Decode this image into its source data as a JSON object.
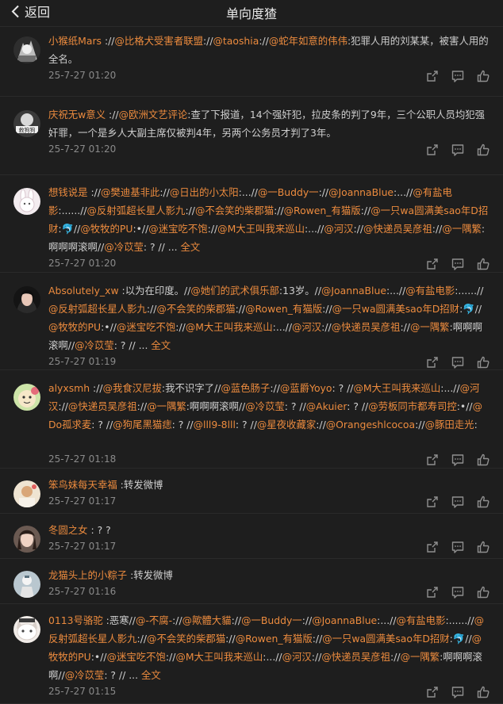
{
  "header": {
    "back_label": "返回",
    "title": "单向度猹"
  },
  "comments": [
    {
      "avatar": "avatar-anime-dark",
      "author": "小猴纸Mars",
      "segments": [
        {
          "t": " ://",
          "k": "n"
        },
        {
          "t": "@比格犬受害者联盟",
          "k": "m"
        },
        {
          "t": "://",
          "k": "n"
        },
        {
          "t": "@taoshia",
          "k": "m"
        },
        {
          "t": "://",
          "k": "n"
        },
        {
          "t": "@蛇年如意的伟伟",
          "k": "m"
        },
        {
          "t": ":犯罪人用的刘某某，被害人用的全名。",
          "k": "n"
        }
      ],
      "time": "25-7-27 01:20"
    },
    {
      "avatar": "avatar-text-badge",
      "author": "庆祝无w意义",
      "segments": [
        {
          "t": " ://",
          "k": "n"
        },
        {
          "t": "@欧洲文艺评论",
          "k": "m"
        },
        {
          "t": ":查了下报道，14个强奸犯，拉皮条的判了9年，三个公职人员均犯强奸罪，一个是乡人大副主席仅被判4年，另两个公务员才判了3年。",
          "k": "n"
        }
      ],
      "time": "25-7-27 01:20"
    },
    {
      "avatar": "avatar-bunny",
      "author": "想钱说是",
      "segments": [
        {
          "t": " ://",
          "k": "n"
        },
        {
          "t": "@樊迪基非此",
          "k": "m"
        },
        {
          "t": "://",
          "k": "n"
        },
        {
          "t": "@日出的小太阳",
          "k": "m"
        },
        {
          "t": ":...//",
          "k": "n"
        },
        {
          "t": "@一Buddy一",
          "k": "m"
        },
        {
          "t": "://",
          "k": "n"
        },
        {
          "t": "@JoannaBlue",
          "k": "m"
        },
        {
          "t": ":...//",
          "k": "n"
        },
        {
          "t": "@有盐电影",
          "k": "m"
        },
        {
          "t": ":......//",
          "k": "n"
        },
        {
          "t": "@反射弧超长星人影九",
          "k": "m"
        },
        {
          "t": "://",
          "k": "n"
        },
        {
          "t": "@不会笑的柴郡猫",
          "k": "m"
        },
        {
          "t": "://",
          "k": "n"
        },
        {
          "t": "@Rowen_有猫版",
          "k": "m"
        },
        {
          "t": "://",
          "k": "n"
        },
        {
          "t": "@一只wa圆满美sao年D招财",
          "k": "m"
        },
        {
          "t": ":🐬//",
          "k": "n"
        },
        {
          "t": "@牧牧的PU",
          "k": "m"
        },
        {
          "t": ":•//",
          "k": "n"
        },
        {
          "t": "@迷宝吃不饱",
          "k": "m"
        },
        {
          "t": "://",
          "k": "n"
        },
        {
          "t": "@M大王叫我来巡山",
          "k": "m"
        },
        {
          "t": ":...//",
          "k": "n"
        },
        {
          "t": "@河汉",
          "k": "m"
        },
        {
          "t": "://",
          "k": "n"
        },
        {
          "t": "@快递员吴彦祖",
          "k": "m"
        },
        {
          "t": "://",
          "k": "n"
        },
        {
          "t": "@一隅繁",
          "k": "m"
        },
        {
          "t": ":啊啊啊滚啊//",
          "k": "n"
        },
        {
          "t": "@冷苡莹",
          "k": "m"
        },
        {
          "t": ": ? // ... ",
          "k": "n"
        },
        {
          "t": "全文",
          "k": "x"
        }
      ],
      "time": "25-7-27 01:20"
    },
    {
      "avatar": "avatar-dark-hair",
      "author": "Absolutely_xw",
      "segments": [
        {
          "t": " :以为在印度。//",
          "k": "n"
        },
        {
          "t": "@她们的武术俱乐部",
          "k": "m"
        },
        {
          "t": ":13岁。//",
          "k": "n"
        },
        {
          "t": "@JoannaBlue",
          "k": "m"
        },
        {
          "t": ":...//",
          "k": "n"
        },
        {
          "t": "@有盐电影",
          "k": "m"
        },
        {
          "t": ":......//",
          "k": "n"
        },
        {
          "t": "@反射弧超长星人影九",
          "k": "m"
        },
        {
          "t": "://",
          "k": "n"
        },
        {
          "t": "@不会笑的柴郡猫",
          "k": "m"
        },
        {
          "t": "://",
          "k": "n"
        },
        {
          "t": "@Rowen_有猫版",
          "k": "m"
        },
        {
          "t": "://",
          "k": "n"
        },
        {
          "t": "@一只wa圆满美sao年D招财",
          "k": "m"
        },
        {
          "t": ":🐬//",
          "k": "n"
        },
        {
          "t": "@牧牧的PU",
          "k": "m"
        },
        {
          "t": ":•//",
          "k": "n"
        },
        {
          "t": "@迷宝吃不饱",
          "k": "m"
        },
        {
          "t": "://",
          "k": "n"
        },
        {
          "t": "@M大王叫我来巡山",
          "k": "m"
        },
        {
          "t": ":...//",
          "k": "n"
        },
        {
          "t": "@河汉",
          "k": "m"
        },
        {
          "t": "://",
          "k": "n"
        },
        {
          "t": "@快递员吴彦祖",
          "k": "m"
        },
        {
          "t": "://",
          "k": "n"
        },
        {
          "t": "@一隅繁",
          "k": "m"
        },
        {
          "t": ":啊啊啊滚啊//",
          "k": "n"
        },
        {
          "t": "@冷苡莹",
          "k": "m"
        },
        {
          "t": ": ? // ... ",
          "k": "n"
        },
        {
          "t": "全文",
          "k": "x"
        }
      ],
      "time": "25-7-27 01:19"
    },
    {
      "avatar": "avatar-green-cartoon",
      "author": "alyxsmh",
      "segments": [
        {
          "t": " ://",
          "k": "n"
        },
        {
          "t": "@我食汉尼拔",
          "k": "m"
        },
        {
          "t": ":我不识字了//",
          "k": "n"
        },
        {
          "t": "@蓝色肠子",
          "k": "m"
        },
        {
          "t": "://",
          "k": "n"
        },
        {
          "t": "@蓝爵Yoyo",
          "k": "m"
        },
        {
          "t": ": ? //",
          "k": "n"
        },
        {
          "t": "@M大王叫我来巡山",
          "k": "m"
        },
        {
          "t": ":...//",
          "k": "n"
        },
        {
          "t": "@河汉",
          "k": "m"
        },
        {
          "t": "://",
          "k": "n"
        },
        {
          "t": "@快递员吴彦祖",
          "k": "m"
        },
        {
          "t": "://",
          "k": "n"
        },
        {
          "t": "@一隅繁",
          "k": "m"
        },
        {
          "t": ":啊啊啊滚啊//",
          "k": "n"
        },
        {
          "t": "@冷苡莹",
          "k": "m"
        },
        {
          "t": ": ? //",
          "k": "n"
        },
        {
          "t": "@Akuier",
          "k": "m"
        },
        {
          "t": ": ? //",
          "k": "n"
        },
        {
          "t": "@劳板同市都寿司控",
          "k": "m"
        },
        {
          "t": ":•//",
          "k": "n"
        },
        {
          "t": "@Do孤求麦",
          "k": "m"
        },
        {
          "t": ": ? //",
          "k": "n"
        },
        {
          "t": "@狗尾黑猫痣",
          "k": "m"
        },
        {
          "t": ": ? //",
          "k": "n"
        },
        {
          "t": "@lll9-8lll",
          "k": "m"
        },
        {
          "t": ": ? //",
          "k": "n"
        },
        {
          "t": "@星夜收藏家",
          "k": "m"
        },
        {
          "t": "://",
          "k": "n"
        },
        {
          "t": "@Orangeshlcocoa",
          "k": "m"
        },
        {
          "t": "://",
          "k": "n"
        },
        {
          "t": "@豚田走光",
          "k": "m"
        },
        {
          "t": ":",
          "k": "n"
        }
      ],
      "time": "25-7-27 01:18"
    },
    {
      "avatar": "avatar-light-photo",
      "author": "笨鸟妹每天幸福",
      "segments": [
        {
          "t": " :转发微博",
          "k": "n"
        }
      ],
      "time": "25-7-27 01:17"
    },
    {
      "avatar": "avatar-portrait",
      "author": "冬圆之女",
      "segments": [
        {
          "t": " : ? ?",
          "k": "n"
        }
      ],
      "time": "25-7-27 01:17"
    },
    {
      "avatar": "avatar-figure",
      "author": "龙猫头上的小粽子",
      "segments": [
        {
          "t": " :转发微博",
          "k": "n"
        }
      ],
      "time": "25-7-27 01:16"
    },
    {
      "avatar": "avatar-cat-face",
      "author": "0113号骆驼",
      "segments": [
        {
          "t": " :恶寒//",
          "k": "n"
        },
        {
          "t": "@-不腐-",
          "k": "m"
        },
        {
          "t": "://",
          "k": "n"
        },
        {
          "t": "@歟體大貓",
          "k": "m"
        },
        {
          "t": "://",
          "k": "n"
        },
        {
          "t": "@一Buddy一",
          "k": "m"
        },
        {
          "t": "://",
          "k": "n"
        },
        {
          "t": "@JoannaBlue",
          "k": "m"
        },
        {
          "t": ":...//",
          "k": "n"
        },
        {
          "t": "@有盐电影",
          "k": "m"
        },
        {
          "t": ":......//",
          "k": "n"
        },
        {
          "t": "@反射弧超长星人影九",
          "k": "m"
        },
        {
          "t": "://",
          "k": "n"
        },
        {
          "t": "@不会笑的柴郡猫",
          "k": "m"
        },
        {
          "t": "://",
          "k": "n"
        },
        {
          "t": "@Rowen_有猫版",
          "k": "m"
        },
        {
          "t": "://",
          "k": "n"
        },
        {
          "t": "@一只wa圆满美sao年D招财",
          "k": "m"
        },
        {
          "t": ":🐬//",
          "k": "n"
        },
        {
          "t": "@牧牧的PU",
          "k": "m"
        },
        {
          "t": ":•//",
          "k": "n"
        },
        {
          "t": "@迷宝吃不饱",
          "k": "m"
        },
        {
          "t": "://",
          "k": "n"
        },
        {
          "t": "@M大王叫我来巡山",
          "k": "m"
        },
        {
          "t": ":...//",
          "k": "n"
        },
        {
          "t": "@河汉",
          "k": "m"
        },
        {
          "t": "://",
          "k": "n"
        },
        {
          "t": "@快递员吴彦祖",
          "k": "m"
        },
        {
          "t": "://",
          "k": "n"
        },
        {
          "t": "@一隅繁",
          "k": "m"
        },
        {
          "t": ":啊啊啊滚啊//",
          "k": "n"
        },
        {
          "t": "@冷苡莹",
          "k": "m"
        },
        {
          "t": ": ? // ... ",
          "k": "n"
        },
        {
          "t": "全文",
          "k": "x"
        }
      ],
      "time": "25-7-27 01:15"
    }
  ],
  "colors": {
    "background": "#1e1e1e",
    "accent": "#ec8b3e",
    "text": "#cfcfcf",
    "meta": "#8a8a8a"
  },
  "action_icons": [
    "share-icon",
    "comment-icon",
    "like-icon"
  ]
}
